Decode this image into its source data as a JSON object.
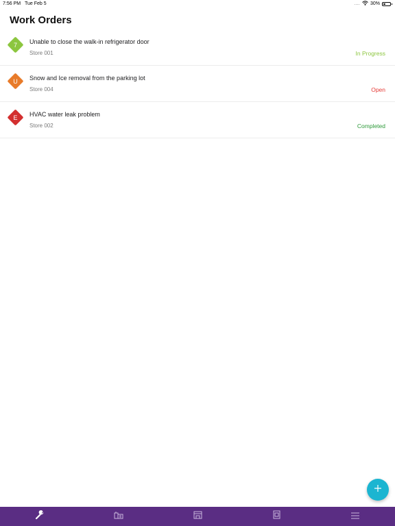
{
  "status_bar": {
    "time": "7:56 PM",
    "date": "Tue Feb 5",
    "signal": "....",
    "battery": "30%",
    "battery_level": 0.3
  },
  "page": {
    "title": "Work Orders"
  },
  "work_orders": [
    {
      "badge": "7",
      "badge_color": "#8cc63f",
      "title": "Unable to close the walk-in refrigerator door",
      "store": "Store 001",
      "status": "In Progress",
      "status_color": "#8cc63f"
    },
    {
      "badge": "U",
      "badge_color": "#e87b2a",
      "title": "Snow and Ice removal from the parking lot",
      "store": "Store 004",
      "status": "Open",
      "status_color": "#e53935"
    },
    {
      "badge": "E",
      "badge_color": "#d32f2f",
      "title": "HVAC water leak problem",
      "store": "Store 002",
      "status": "Completed",
      "status_color": "#2e9a3a"
    }
  ],
  "fab": {
    "icon": "plus-icon",
    "color": "#1bb5d1"
  },
  "tab_bar": {
    "color": "#5a2d83",
    "tabs": [
      {
        "icon": "wrench-icon",
        "active": true
      },
      {
        "icon": "building-icon",
        "active": false
      },
      {
        "icon": "storefront-icon",
        "active": false
      },
      {
        "icon": "invoice-icon",
        "active": false
      },
      {
        "icon": "menu-icon",
        "active": false
      }
    ]
  }
}
